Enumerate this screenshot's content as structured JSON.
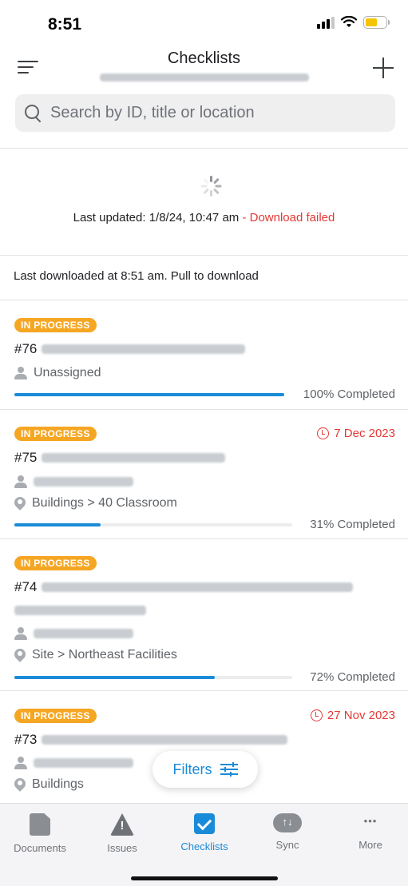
{
  "status_bar": {
    "time": "8:51"
  },
  "header": {
    "title": "Checklists"
  },
  "search": {
    "placeholder": "Search by ID, title or location"
  },
  "update": {
    "last_updated": "Last updated: 1/8/24, 10:47 am",
    "failed": " - Download failed"
  },
  "pull_text": "Last downloaded at 8:51 am. Pull to download",
  "cards": [
    {
      "badge": "IN PROGRESS",
      "id": "#76",
      "assignee": "Unassigned",
      "progress": 1.0,
      "pct_label": "100% Completed"
    },
    {
      "badge": "IN PROGRESS",
      "id": "#75",
      "due": "7 Dec 2023",
      "location": "Buildings > 40 Classroom",
      "progress": 0.31,
      "pct_label": "31% Completed"
    },
    {
      "badge": "IN PROGRESS",
      "id": "#74",
      "location": "Site > Northeast Facilities",
      "progress": 0.72,
      "pct_label": "72% Completed"
    },
    {
      "badge": "IN PROGRESS",
      "id": "#73",
      "due": "27 Nov 2023",
      "location": "Buildings"
    }
  ],
  "filters": {
    "label": "Filters"
  },
  "tabs": [
    {
      "label": "Documents",
      "icon": "document-icon"
    },
    {
      "label": "Issues",
      "icon": "warning-icon"
    },
    {
      "label": "Checklists",
      "icon": "checklist-icon",
      "active": true
    },
    {
      "label": "Sync",
      "icon": "sync-icon"
    },
    {
      "label": "More",
      "icon": "more-icon"
    }
  ],
  "colors": {
    "accent": "#1a8bd8",
    "badge": "#f5a623",
    "error": "#e53935"
  }
}
